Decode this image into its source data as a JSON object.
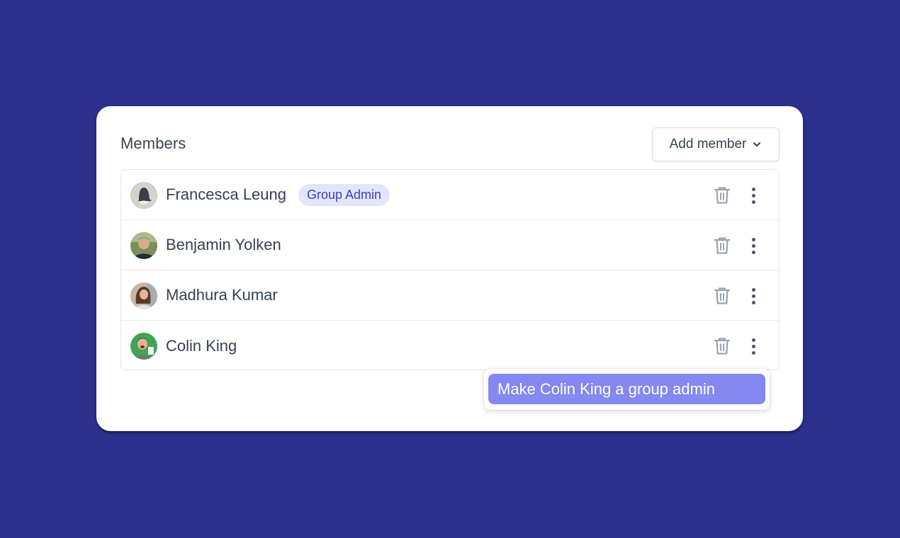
{
  "panel": {
    "title": "Members",
    "add_member_label": "Add member",
    "add_member_icon": "chevron-down-icon"
  },
  "members": [
    {
      "name": "Francesca Leung",
      "badge": "Group Admin",
      "avatar": "avatar-knit-hat"
    },
    {
      "name": "Benjamin Yolken",
      "badge": null,
      "avatar": "avatar-man-outdoors"
    },
    {
      "name": "Madhura Kumar",
      "badge": null,
      "avatar": "avatar-woman-long-hair"
    },
    {
      "name": "Colin King",
      "badge": null,
      "avatar": "avatar-man-green-bg"
    }
  ],
  "row_actions": {
    "delete_icon": "trash-icon",
    "more_icon": "kebab-menu-icon"
  },
  "context_menu": {
    "items": [
      {
        "label": "Make Colin King a group admin",
        "highlighted": true
      }
    ]
  },
  "colors": {
    "background": "#2b318b",
    "badge_bg": "#e2e6fd",
    "badge_text": "#3b3fb8",
    "menu_highlight": "#8588f0"
  }
}
